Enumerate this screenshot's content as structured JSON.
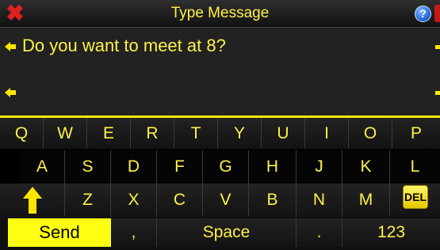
{
  "window": {
    "title": "Type Message"
  },
  "icons": {
    "close": "close-icon",
    "help": "help-icon",
    "cursor": "left-arrow-icon",
    "shift": "shift-arrow-up-icon"
  },
  "message": {
    "text": "Do you want to meet at 8?"
  },
  "keyboard": {
    "row1": [
      "Q",
      "W",
      "E",
      "R",
      "T",
      "Y",
      "U",
      "I",
      "O",
      "P"
    ],
    "row2": [
      "A",
      "S",
      "D",
      "F",
      "G",
      "H",
      "J",
      "K",
      "L"
    ],
    "row3": [
      "Z",
      "X",
      "C",
      "V",
      "B",
      "N",
      "M"
    ],
    "del": "DEL",
    "send": "Send",
    "comma": ",",
    "space": "Space",
    "period": ".",
    "numbers": "123"
  },
  "colors": {
    "accent": "#ffe600",
    "text": "#fff04a",
    "background": "#000000"
  }
}
